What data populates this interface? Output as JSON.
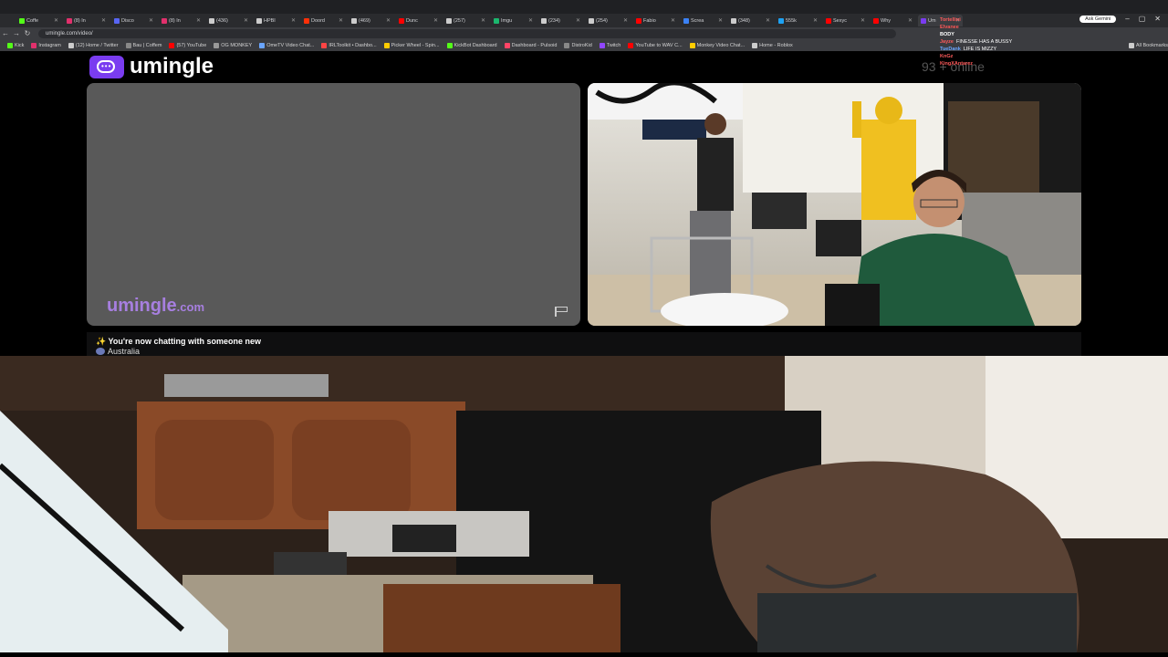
{
  "browser": {
    "tabs": [
      {
        "label": "Coffe",
        "color": "#53fc18"
      },
      {
        "label": "(8) In",
        "color": "#e1306c"
      },
      {
        "label": "Disco",
        "color": "#5865f2"
      },
      {
        "label": "(8) In",
        "color": "#e1306c"
      },
      {
        "label": "(436)",
        "color": "#cccccc"
      },
      {
        "label": "HPBI",
        "color": "#cccccc"
      },
      {
        "label": "Doord",
        "color": "#ff3008"
      },
      {
        "label": "(469)",
        "color": "#cccccc"
      },
      {
        "label": "Dunc",
        "color": "#ff0000"
      },
      {
        "label": "(257)",
        "color": "#cccccc"
      },
      {
        "label": "Imgu",
        "color": "#1bb76e"
      },
      {
        "label": "(234)",
        "color": "#cccccc"
      },
      {
        "label": "(254)",
        "color": "#cccccc"
      },
      {
        "label": "Fabio",
        "color": "#ff0000"
      },
      {
        "label": "Screa",
        "color": "#3b82f6"
      },
      {
        "label": "(348)",
        "color": "#cccccc"
      },
      {
        "label": "555k",
        "color": "#1da1f2"
      },
      {
        "label": "Sexyc",
        "color": "#ff0000"
      },
      {
        "label": "Why",
        "color": "#ff0000"
      },
      {
        "label": "Um",
        "color": "#7a3cf0"
      }
    ],
    "ask_gemini": "Ask Gemini",
    "url": "umingle.com/video/",
    "bookmarks": [
      {
        "label": "Kick",
        "color": "#53fc18"
      },
      {
        "label": "Instagram",
        "color": "#e1306c"
      },
      {
        "label": "(12) Home / Twitter",
        "color": "#cccccc"
      },
      {
        "label": "Bau | Coffem",
        "color": "#888888"
      },
      {
        "label": "(57) YouTube",
        "color": "#ff0000"
      },
      {
        "label": "OG MONKEY",
        "color": "#999999"
      },
      {
        "label": "OmeTV Video Chat...",
        "color": "#6aa5ff"
      },
      {
        "label": "IRLToolkit • Dashbo...",
        "color": "#ff4444"
      },
      {
        "label": "Picker Wheel - Spin...",
        "color": "#ffcc00"
      },
      {
        "label": "KickBot Dashboard",
        "color": "#53fc18"
      },
      {
        "label": "Dashboard - Pulsoid",
        "color": "#ff4466"
      },
      {
        "label": "DistroKid",
        "color": "#888888"
      },
      {
        "label": "Twitch",
        "color": "#9146ff"
      },
      {
        "label": "YouTube to WAV C...",
        "color": "#ff0000"
      },
      {
        "label": "Monkey Video Chat...",
        "color": "#ffcc00"
      },
      {
        "label": "Home - Roblox",
        "color": "#cccccc"
      },
      {
        "label": "All Bookmarks",
        "color": "#cccccc"
      }
    ]
  },
  "site": {
    "logo_text": "umingle",
    "watermark_name": "umingle",
    "watermark_tld": ".com",
    "online_count": "93 + online",
    "status_message": "✨ You're now chatting with someone new",
    "country": "Australia"
  },
  "chat": [
    {
      "user": "Tortellini",
      "text": "",
      "color": "#ff5a5a"
    },
    {
      "user": "Elvanee",
      "text": "",
      "color": "#ff5a5a"
    },
    {
      "user": "BODY",
      "text": "",
      "color": "#ffffff"
    },
    {
      "user": "Jayze",
      "text": "FINESSE HAS A BUSSY",
      "color": "#ff5a5a"
    },
    {
      "user": "TueDank",
      "text": "LIFE IS MIZZY",
      "color": "#6aa5ff"
    },
    {
      "user": "KnGz",
      "text": "",
      "color": "#ff5a5a"
    },
    {
      "user": "KingXAntarez",
      "text": "",
      "color": "#ff5a5a"
    }
  ],
  "colors": {
    "accent": "#7a3cf0"
  }
}
